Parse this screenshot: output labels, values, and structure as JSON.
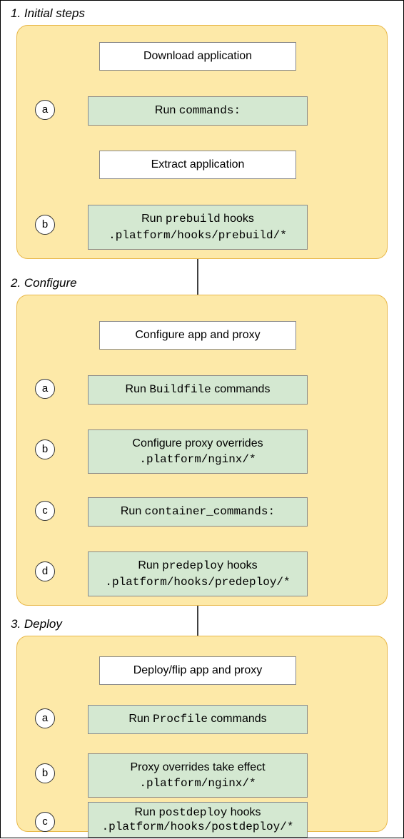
{
  "sections": {
    "s1": {
      "title": "1. Initial steps"
    },
    "s2": {
      "title": "2. Configure"
    },
    "s3": {
      "title": "3. Deploy"
    }
  },
  "bullets": {
    "s1a": "a",
    "s1b": "b",
    "s2a": "a",
    "s2b": "b",
    "s2c": "c",
    "s2d": "d",
    "s3a": "a",
    "s3b": "b",
    "s3c": "c"
  },
  "boxes": {
    "b1": {
      "pre": "",
      "mid": "Download application",
      "post": "",
      "sub": ""
    },
    "b2": {
      "pre": "Run ",
      "mid": "commands:",
      "post": "",
      "sub": ""
    },
    "b3": {
      "pre": "",
      "mid": "Extract application",
      "post": "",
      "sub": ""
    },
    "b4": {
      "pre": "Run ",
      "mid": "prebuild",
      "post": " hooks",
      "sub": ".platform/hooks/prebuild/*"
    },
    "b5": {
      "pre": "",
      "mid": "Configure app and proxy",
      "post": "",
      "sub": ""
    },
    "b6": {
      "pre": "Run ",
      "mid": "Buildfile",
      "post": " commands",
      "sub": ""
    },
    "b7": {
      "pre": "",
      "mid": "Configure proxy overrides",
      "post": "",
      "sub": ".platform/nginx/*"
    },
    "b8": {
      "pre": "Run ",
      "mid": "container_commands:",
      "post": "",
      "sub": ""
    },
    "b9": {
      "pre": "Run ",
      "mid": "predeploy",
      "post": " hooks",
      "sub": ".platform/hooks/predeploy/*"
    },
    "b10": {
      "pre": "",
      "mid": "Deploy/flip app and proxy",
      "post": "",
      "sub": ""
    },
    "b11": {
      "pre": "Run ",
      "mid": "Procfile",
      "post": " commands",
      "sub": ""
    },
    "b12": {
      "pre": "",
      "mid": "Proxy overrides take effect",
      "post": "",
      "sub": ".platform/nginx/*"
    },
    "b13": {
      "pre": "Run ",
      "mid": "postdeploy",
      "post": " hooks",
      "sub": ".platform/hooks/postdeploy/*"
    }
  }
}
